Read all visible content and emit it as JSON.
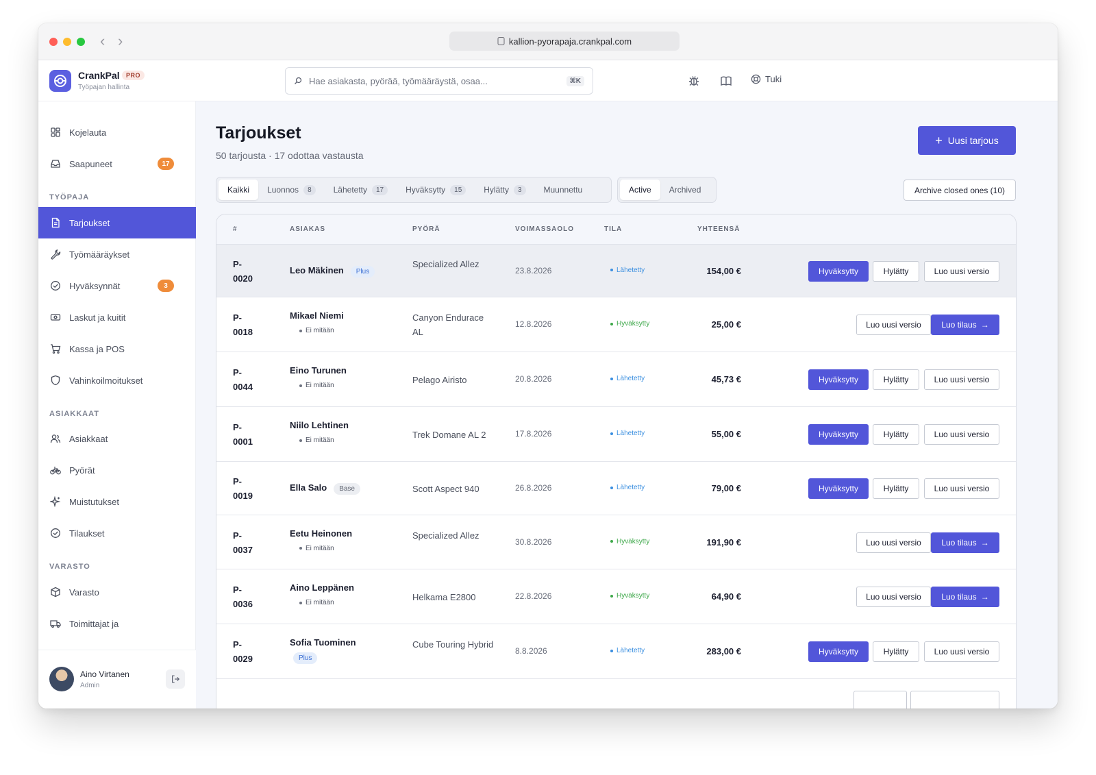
{
  "browser": {
    "url": "kallion-pyorapaja.crankpal.com"
  },
  "brand": {
    "name": "CrankPal",
    "badge": "PRO",
    "subtitle": "Työpajan hallinta"
  },
  "search": {
    "placeholder": "Hae asiakasta, pyörää, työmääräystä, osaa...",
    "shortcut": "⌘K"
  },
  "header": {
    "support_label": "Tuki"
  },
  "sidebar": {
    "items": [
      {
        "label": "Kojelauta",
        "icon": "dashboard-icon"
      },
      {
        "label": "Saapuneet",
        "icon": "inbox-icon",
        "badge": "17"
      },
      {
        "label": "Tarjoukset",
        "icon": "document-icon",
        "active": true
      },
      {
        "label": "Työmääräykset",
        "icon": "wrench-icon"
      },
      {
        "label": "Hyväksynnät",
        "icon": "check-circle-icon",
        "badge": "3"
      },
      {
        "label": "Laskut ja kuitit",
        "icon": "receipt-icon"
      },
      {
        "label": "Kassa ja POS",
        "icon": "cart-icon"
      },
      {
        "label": "Vahinkoilmoitukset",
        "icon": "shield-icon"
      },
      {
        "label": "Asiakkaat",
        "icon": "users-icon"
      },
      {
        "label": "Pyörät",
        "icon": "bike-icon"
      },
      {
        "label": "Muistutukset",
        "icon": "sparkle-icon"
      },
      {
        "label": "Tilaukset",
        "icon": "check-circle-icon"
      },
      {
        "label": "Varasto",
        "icon": "box-icon"
      },
      {
        "label": "Toimittajat ja",
        "icon": "truck-icon"
      }
    ],
    "sections": [
      "TYÖPAJA",
      "ASIAKKAAT",
      "VARASTO"
    ],
    "user": {
      "name": "Aino Virtanen",
      "role": "Admin"
    }
  },
  "page": {
    "title": "Tarjoukset",
    "subtitle": "50 tarjousta · 17 odottaa vastausta",
    "new_button": "Uusi tarjous",
    "archive_button": "Archive closed ones (10)"
  },
  "filters": {
    "status": [
      {
        "label": "Kaikki",
        "active": true
      },
      {
        "label": "Luonnos",
        "count": "8"
      },
      {
        "label": "Lähetetty",
        "count": "17"
      },
      {
        "label": "Hyväksytty",
        "count": "15"
      },
      {
        "label": "Hylätty",
        "count": "3"
      },
      {
        "label": "Muunnettu"
      }
    ],
    "view": [
      {
        "label": "Active",
        "active": true
      },
      {
        "label": "Archived"
      }
    ]
  },
  "table": {
    "columns": [
      "#",
      "ASIAKAS",
      "PYÖRÄ",
      "VOIMASSAOLO",
      "TILA",
      "YHTEENSÄ"
    ],
    "rows": [
      {
        "id_prefix": "P-",
        "id_num": "0020",
        "customer": "Leo Mäkinen",
        "tier": "Plus",
        "tier_kind": "plus",
        "sub": "",
        "bike": "Specialized Allez",
        "valid": "23.8.2026",
        "status": "Lähetetty",
        "total": "154,00 €"
      },
      {
        "id_prefix": "P-",
        "id_num": "0018",
        "customer": "Mikael Niemi",
        "tier": "",
        "tier_kind": "",
        "sub": "Ei mitään",
        "bike": "Canyon Endurace AL",
        "valid": "12.8.2026",
        "status": "Hyväksytty",
        "total": "25,00 €"
      },
      {
        "id_prefix": "P-",
        "id_num": "0044",
        "customer": "Eino Turunen",
        "tier": "",
        "tier_kind": "",
        "sub": "Ei mitään",
        "bike": "Pelago Airisto",
        "valid": "20.8.2026",
        "status": "Lähetetty",
        "total": "45,73 €"
      },
      {
        "id_prefix": "P-",
        "id_num": "0001",
        "customer": "Niilo Lehtinen",
        "tier": "",
        "tier_kind": "",
        "sub": "Ei mitään",
        "bike": "Trek Domane AL 2",
        "valid": "17.8.2026",
        "status": "Lähetetty",
        "total": "55,00 €"
      },
      {
        "id_prefix": "P-",
        "id_num": "0019",
        "customer": "Ella Salo",
        "tier": "Base",
        "tier_kind": "base",
        "sub": "",
        "bike": "Scott Aspect 940",
        "valid": "26.8.2026",
        "status": "Lähetetty",
        "total": "79,00 €"
      },
      {
        "id_prefix": "P-",
        "id_num": "0037",
        "customer": "Eetu Heinonen",
        "tier": "",
        "tier_kind": "",
        "sub": "Ei mitään",
        "bike": "Specialized Allez",
        "valid": "30.8.2026",
        "status": "Hyväksytty",
        "total": "191,90 €"
      },
      {
        "id_prefix": "P-",
        "id_num": "0036",
        "customer": "Aino Leppänen",
        "tier": "",
        "tier_kind": "",
        "sub": "Ei mitään",
        "bike": "Helkama E2800",
        "valid": "22.8.2026",
        "status": "Hyväksytty",
        "total": "64,90 €"
      },
      {
        "id_prefix": "P-",
        "id_num": "0029",
        "customer": "Sofia Tuominen",
        "tier": "Plus",
        "tier_kind": "plus-below",
        "sub": "",
        "bike": "Cube Touring Hybrid",
        "valid": "8.8.2026",
        "status": "Lähetetty",
        "total": "283,00 €"
      }
    ],
    "actions": {
      "approve": "Hyväksytty",
      "reject": "Hylätty",
      "new_version": "Luo uusi versio",
      "create_order": "Luo tilaus"
    }
  },
  "colors": {
    "accent": "#5256d9",
    "status_sent": "#3b8fe0",
    "status_approved": "#3ea84a",
    "badge_orange": "#ef8c3a"
  }
}
